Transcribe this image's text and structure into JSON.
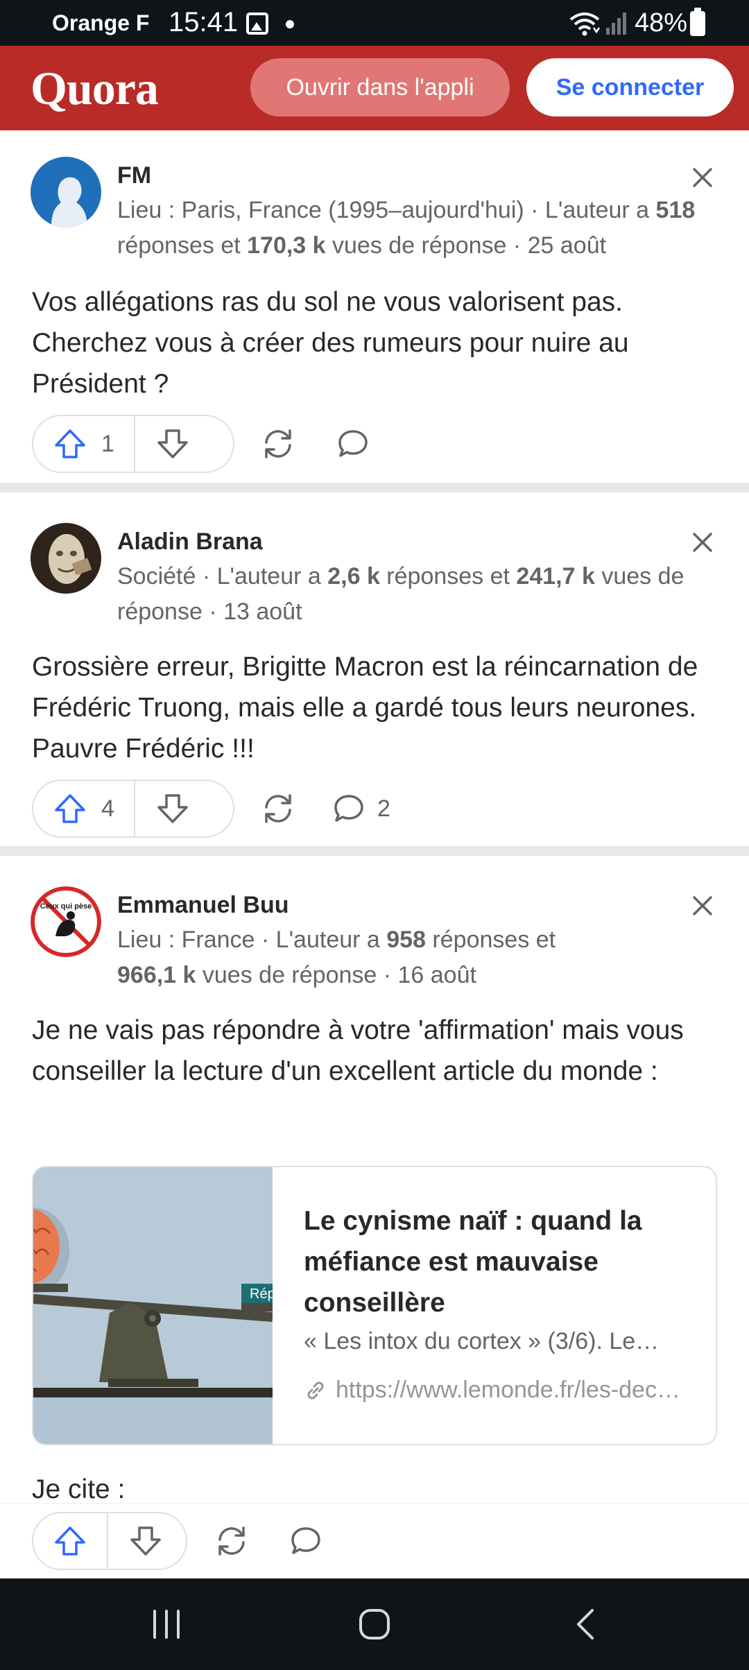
{
  "status_bar": {
    "carrier": "Orange F",
    "time": "15:41",
    "battery": "48%",
    "icons": [
      "image-icon",
      "dot-icon",
      "wifi-icon",
      "signal-icon",
      "battery-icon"
    ]
  },
  "header": {
    "logo": "Quora",
    "open_app_label": "Ouvrir dans l'appli",
    "login_label": "Se connecter",
    "brand_color": "#b92b27"
  },
  "comments": [
    {
      "author": "FM",
      "meta_pre": "Lieu : Paris, France (1995–aujourd'hui) · L'auteur a ",
      "answers": "518",
      "meta_mid": " réponses et ",
      "views": "170,3 k",
      "meta_post": " vues de réponse · 25 août",
      "text": "Vos allégations ras du sol ne vous valorisent pas. Cherchez vous à créer des rumeurs pour nuire au Président ?",
      "upvotes": "1",
      "comment_count": ""
    },
    {
      "author": "Aladin Brana",
      "meta_pre": "Société · L'auteur a ",
      "answers": "2,6 k",
      "meta_mid": " réponses et ",
      "views": "241,7 k",
      "meta_post": " vues de réponse · 13 août",
      "text": "Grossière erreur, Brigitte Macron est la réincarnation de Frédéric Truong, mais elle a gardé tous leurs neurones. Pauvre Frédéric !!!",
      "upvotes": "4",
      "comment_count": "2"
    },
    {
      "author": "Emmanuel Buu",
      "meta_pre": "Lieu : France · L'auteur a ",
      "answers": "958",
      "meta_mid": " réponses et ",
      "views": "966,1 k",
      "meta_post": " vues de réponse · 16 août",
      "text": "Je ne vais pas répondre à votre 'affirmation' mais vous conseiller la lecture d'un excellent article du monde :",
      "upvotes": "",
      "comment_count": "",
      "avatar_text": "Ceux qui pèse",
      "link": {
        "title": "Le cynisme naïf : quand la méfiance est mauvaise conseillère",
        "description": "« Les intox du cortex » (3/6). Le…",
        "url": "https://www.lemonde.fr/les-dec…",
        "thumb_label": "Rép"
      },
      "continuation": "Je cite :"
    }
  ],
  "nav_bar": {
    "buttons": [
      "recent-apps-icon",
      "home-icon",
      "back-icon"
    ]
  }
}
